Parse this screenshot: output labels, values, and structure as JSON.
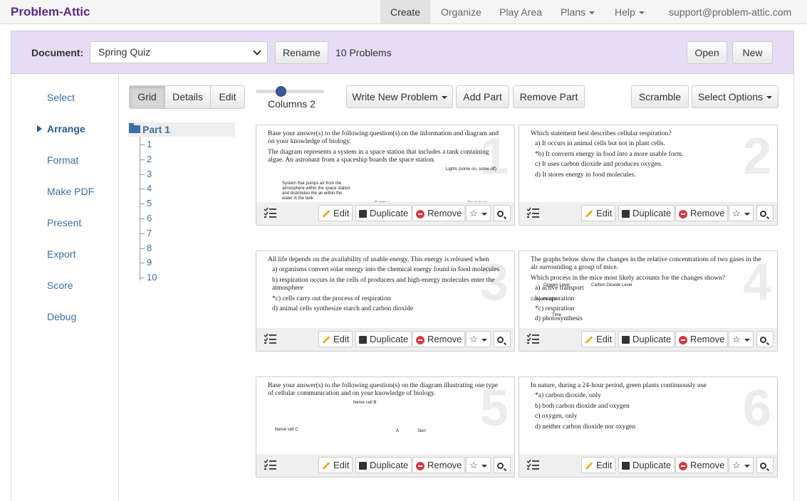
{
  "nav": {
    "brand": "Problem-Attic",
    "items": [
      "Create",
      "Organize",
      "Play Area",
      "Plans",
      "Help"
    ],
    "account": "support@problem-attic.com"
  },
  "docbar": {
    "label": "Document:",
    "selected": "Spring Quiz",
    "rename": "Rename",
    "count": "10 Problems",
    "open": "Open",
    "new": "New"
  },
  "sidebar": [
    "Select",
    "Arrange",
    "Format",
    "Make PDF",
    "Present",
    "Export",
    "Score",
    "Debug"
  ],
  "toolbar": {
    "views": [
      "Grid",
      "Details",
      "Edit"
    ],
    "columns_label": "Columns 2",
    "write_new": "Write New Problem",
    "add_part": "Add Part",
    "remove_part": "Remove Part",
    "scramble": "Scramble",
    "select_options": "Select Options"
  },
  "tree": {
    "part": "Part 1",
    "items": [
      "1",
      "2",
      "3",
      "4",
      "5",
      "6",
      "7",
      "8",
      "9",
      "10"
    ]
  },
  "card_buttons": {
    "edit": "Edit",
    "duplicate": "Duplicate",
    "remove": "Remove",
    "star": "☆"
  },
  "cards": [
    {
      "num": "1",
      "lines": [
        "Base your answer(s) to the following question(s) on the information and diagram and on your knowledge of biology.",
        "The diagram represents a system in a space station that includes a tank containing algae. An astronaut from a spaceship boards the space station."
      ],
      "fig": [
        "Lights (some on, some off)",
        "System that pumps air from the atmosphere within the space station and distributes the air within the water in the tank",
        "Bubbles",
        "Open tank"
      ]
    },
    {
      "num": "2",
      "lines": [
        "Which statement best describes cellular respiration?",
        "a)  It occurs in animal cells but not in plant cells.",
        "*b)  It converts energy in food into a more usable form.",
        "c)  It uses carbon dioxide and produces oxygen.",
        "d)  It stores energy in food molecules."
      ]
    },
    {
      "num": "3",
      "lines": [
        "All life depends on the availability of usable energy. This energy is released when",
        "a)  organisms convert solar energy into the chemical energy found in food molecules",
        "b)  respiration occurs in the cells of producers and high-energy molecules enter the atmosphere",
        "*c)  cells carry out the process of respiration",
        "d)  animal cells synthesize starch and carbon dioxide"
      ]
    },
    {
      "num": "4",
      "lines": [
        "The graphs below show the changes in the relative concentrations of two gases in the air surrounding a group of mice.",
        "Which process in the mice most likely accounts for the changes shown?",
        "a)  active transport",
        "b)  evaporation",
        "*c)  respiration",
        "d)  photosynthesis"
      ],
      "fig": [
        "Oxygen Level",
        "Carbon Dioxide Level",
        "Concentration",
        "Time"
      ]
    },
    {
      "num": "5",
      "lines": [
        "Base your answer(s) to the following question(s) on the diagram illustrating one type of cellular communication and on your knowledge of biology."
      ],
      "fig": [
        "Nerve cell B",
        "Nerve cell C",
        "A",
        "Skin"
      ]
    },
    {
      "num": "6",
      "lines": [
        "In nature, during a 24-hour period, green plants continuously use",
        "*a)  carbon dioxide, only",
        "b)  both carbon dioxide and oxygen",
        "c)  oxygen, only",
        "d)  neither carbon dioxide nor oxygen"
      ]
    }
  ]
}
